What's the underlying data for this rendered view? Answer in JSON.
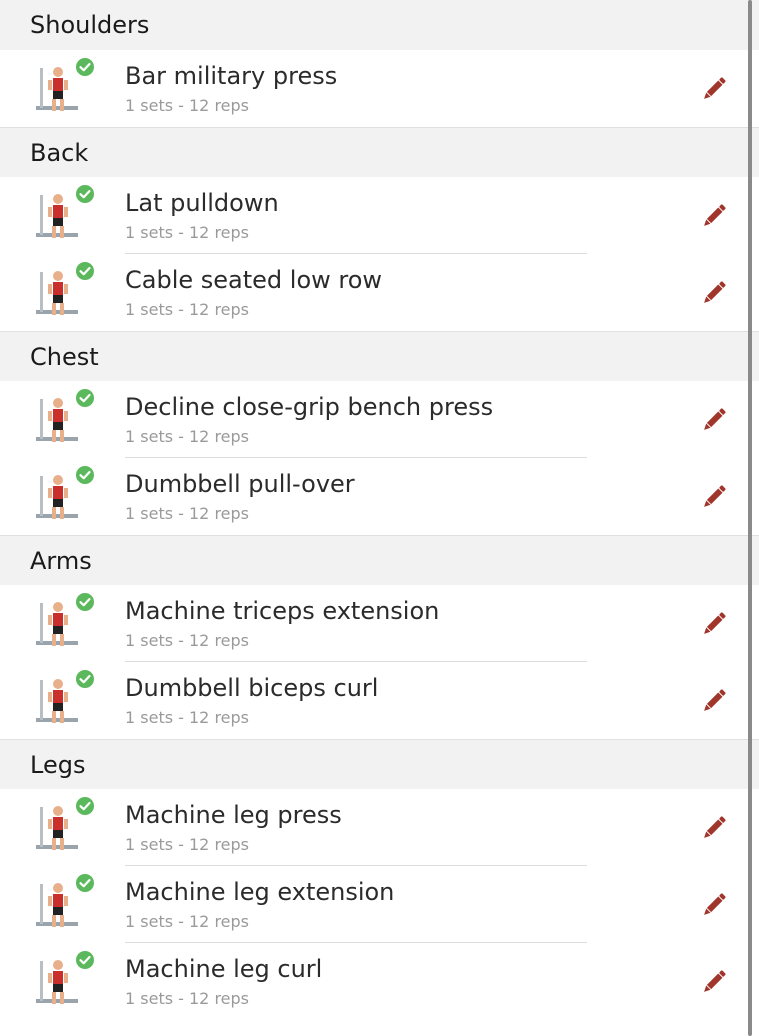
{
  "sections": [
    {
      "title": "Shoulders",
      "exercises": [
        {
          "name": "Bar military press",
          "detail": "1 sets - 12 reps"
        }
      ]
    },
    {
      "title": "Back",
      "exercises": [
        {
          "name": "Lat pulldown",
          "detail": "1 sets - 12 reps"
        },
        {
          "name": "Cable seated low row",
          "detail": "1 sets - 12 reps"
        }
      ]
    },
    {
      "title": "Chest",
      "exercises": [
        {
          "name": "Decline close-grip bench press",
          "detail": "1 sets - 12 reps"
        },
        {
          "name": "Dumbbell pull-over",
          "detail": "1 sets - 12 reps"
        }
      ]
    },
    {
      "title": "Arms",
      "exercises": [
        {
          "name": "Machine triceps extension",
          "detail": "1 sets - 12 reps"
        },
        {
          "name": "Dumbbell biceps curl",
          "detail": "1 sets - 12 reps"
        }
      ]
    },
    {
      "title": "Legs",
      "exercises": [
        {
          "name": "Machine leg press",
          "detail": "1 sets - 12 reps"
        },
        {
          "name": "Machine leg extension",
          "detail": "1 sets - 12 reps"
        },
        {
          "name": "Machine leg curl",
          "detail": "1 sets - 12 reps"
        }
      ]
    }
  ],
  "icons": {
    "completed": "check-circle-icon",
    "edit": "pencil-icon"
  },
  "colors": {
    "edit_icon": "#a0352b",
    "check_badge": "#5cb85c",
    "header_bg": "#f2f2f2"
  }
}
